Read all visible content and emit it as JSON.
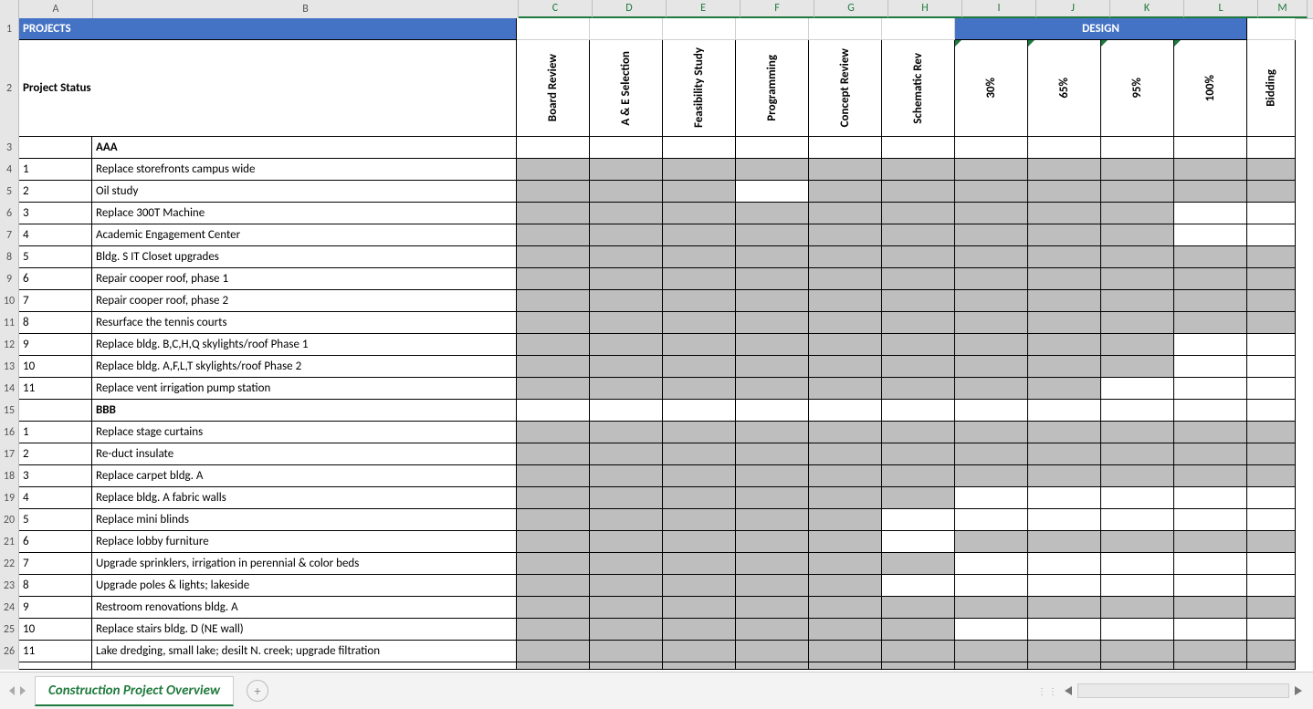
{
  "columns": {
    "row_hdr_w": 20,
    "letters": [
      "A",
      "B",
      "C",
      "D",
      "E",
      "F",
      "G",
      "H",
      "I",
      "J",
      "K",
      "L",
      "M"
    ],
    "widths": [
      80,
      465,
      80,
      80,
      80,
      80,
      80,
      80,
      80,
      80,
      80,
      80,
      53
    ],
    "green_cols": [
      "C",
      "D",
      "E",
      "F",
      "G",
      "H",
      "I",
      "J",
      "K",
      "L",
      "M"
    ]
  },
  "row_numbers": [
    "1",
    "2",
    "3",
    "4",
    "5",
    "6",
    "7",
    "8",
    "9",
    "10",
    "11",
    "12",
    "13",
    "14",
    "15",
    "16",
    "17",
    "18",
    "19",
    "20",
    "21",
    "22",
    "23",
    "24",
    "25",
    "26"
  ],
  "header": {
    "projects": "PROJECTS",
    "design": "DESIGN",
    "project_status": "Project Status",
    "cols": [
      "Board Review",
      "A & E Selection",
      "Feasibility Study",
      "Programming",
      "Concept Review",
      "Schematic Rev",
      "30%",
      "65%",
      "95%",
      "100%",
      "Bidding"
    ]
  },
  "note_cols_design": [
    "I",
    "J",
    "K",
    "L"
  ],
  "rows": [
    {
      "num": "",
      "name": "AAA",
      "bold": true,
      "fill": []
    },
    {
      "num": "1",
      "name": "Replace storefronts campus wide",
      "fill": [
        "C",
        "D",
        "E",
        "F",
        "G",
        "H",
        "I",
        "J",
        "K",
        "L",
        "M"
      ]
    },
    {
      "num": "2",
      "name": "Oil study",
      "fill": [
        "C",
        "D",
        "E",
        "G",
        "H",
        "I",
        "J",
        "K",
        "L",
        "M"
      ]
    },
    {
      "num": "3",
      "name": "Replace 300T Machine",
      "fill": [
        "C",
        "D",
        "E",
        "F",
        "G",
        "H",
        "I",
        "J",
        "K"
      ]
    },
    {
      "num": "4",
      "name": "Academic Engagement Center",
      "fill": [
        "C",
        "D",
        "E",
        "F",
        "G",
        "H",
        "I",
        "J",
        "K"
      ]
    },
    {
      "num": "5",
      "name": "Bldg. S IT Closet upgrades",
      "fill": [
        "C",
        "D",
        "E",
        "F",
        "G",
        "H",
        "I",
        "J",
        "K",
        "L",
        "M"
      ]
    },
    {
      "num": "6",
      "name": "Repair cooper roof, phase 1",
      "fill": [
        "C",
        "D",
        "E",
        "F",
        "G",
        "H",
        "I",
        "J",
        "K",
        "L",
        "M"
      ]
    },
    {
      "num": "7",
      "name": "Repair cooper roof, phase 2",
      "fill": [
        "C",
        "D",
        "E",
        "F",
        "G",
        "H",
        "I",
        "J",
        "K",
        "L",
        "M"
      ]
    },
    {
      "num": "8",
      "name": "Resurface the tennis courts",
      "fill": [
        "C",
        "D",
        "E",
        "F",
        "G",
        "H",
        "I",
        "J",
        "K",
        "L",
        "M"
      ]
    },
    {
      "num": "9",
      "name": "Replace bldg. B,C,H,Q skylights/roof Phase 1",
      "fill": [
        "C",
        "D",
        "E",
        "F",
        "G",
        "H",
        "I",
        "J",
        "K"
      ]
    },
    {
      "num": "10",
      "name": "Replace bldg. A,F,L,T skylights/roof Phase 2",
      "fill": [
        "C",
        "D",
        "E",
        "F",
        "G",
        "H",
        "I",
        "J",
        "K"
      ]
    },
    {
      "num": "11",
      "name": "Replace vent irrigation pump station",
      "fill": [
        "C",
        "D",
        "E",
        "F",
        "G",
        "H",
        "I",
        "J"
      ]
    },
    {
      "num": "",
      "name": "BBB",
      "bold": true,
      "fill": []
    },
    {
      "num": "1",
      "name": "Replace stage curtains",
      "fill": [
        "C",
        "D",
        "E",
        "F",
        "G",
        "H",
        "I",
        "J",
        "K",
        "L",
        "M"
      ]
    },
    {
      "num": "2",
      "name": "Re-duct insulate",
      "fill": [
        "C",
        "D",
        "E",
        "F",
        "G",
        "H",
        "I",
        "J",
        "K",
        "L",
        "M"
      ]
    },
    {
      "num": "3",
      "name": "Replace carpet bldg. A",
      "fill": [
        "C",
        "D",
        "E",
        "F",
        "G",
        "H",
        "I",
        "J",
        "K",
        "L",
        "M"
      ]
    },
    {
      "num": "4",
      "name": "Replace bldg. A fabric walls",
      "fill": [
        "C",
        "D",
        "E",
        "F",
        "G",
        "H"
      ]
    },
    {
      "num": "5",
      "name": "Replace mini blinds",
      "fill": [
        "C",
        "D",
        "E",
        "F",
        "G"
      ]
    },
    {
      "num": "6",
      "name": "Replace lobby furniture",
      "fill": [
        "C",
        "D",
        "E",
        "F",
        "G",
        "I",
        "J",
        "K",
        "L",
        "M"
      ]
    },
    {
      "num": "7",
      "name": "Upgrade sprinklers, irrigation in perennial & color beds",
      "fill": [
        "C",
        "D",
        "E",
        "F",
        "G",
        "H"
      ]
    },
    {
      "num": "8",
      "name": "Upgrade poles & lights; lakeside",
      "fill": [
        "C",
        "D",
        "E",
        "F",
        "G"
      ]
    },
    {
      "num": "9",
      "name": "Restroom renovations bldg. A",
      "fill": [
        "C",
        "D",
        "E",
        "F",
        "G",
        "H",
        "I",
        "J",
        "K",
        "L",
        "M"
      ]
    },
    {
      "num": "10",
      "name": "Replace stairs bldg. D (NE wall)",
      "fill": [
        "C",
        "D",
        "E",
        "F",
        "G",
        "H"
      ]
    },
    {
      "num": "11",
      "name": "Lake dredging, small lake; desilt N. creek; upgrade filtration",
      "fill": [
        "C",
        "D",
        "E",
        "F",
        "G",
        "H",
        "I",
        "J",
        "K",
        "L",
        "M"
      ]
    }
  ],
  "tab": {
    "name": "Construction Project Overview"
  }
}
